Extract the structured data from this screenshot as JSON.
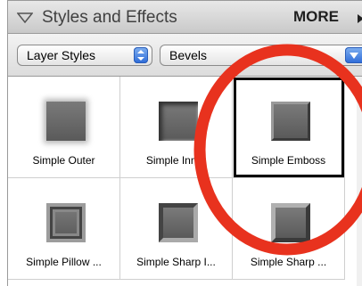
{
  "header": {
    "title": "Styles and Effects",
    "more_label": "MORE",
    "collapse_icon": "triangle-down-icon",
    "more_icon": "triangle-right-icon"
  },
  "toolbar": {
    "category": {
      "value": "Layer Styles",
      "icon": "stepper-icon"
    },
    "subcategory": {
      "value": "Bevels",
      "icon": "chevron-down-icon"
    }
  },
  "tiles": [
    {
      "label": "Simple Outer",
      "style": "outer"
    },
    {
      "label": "Simple Inner",
      "style": "inner"
    },
    {
      "label": "Simple Emboss",
      "style": "emboss",
      "selected": true
    },
    {
      "label": "Simple Pillow ...",
      "style": "pillow"
    },
    {
      "label": "Simple Sharp I...",
      "style": "sharp-inner"
    },
    {
      "label": "Simple Sharp ...",
      "style": "sharp-outer"
    }
  ],
  "colors": {
    "annotation": "#e8321e",
    "selection": "#000000",
    "accent": "#2d6ad8"
  }
}
